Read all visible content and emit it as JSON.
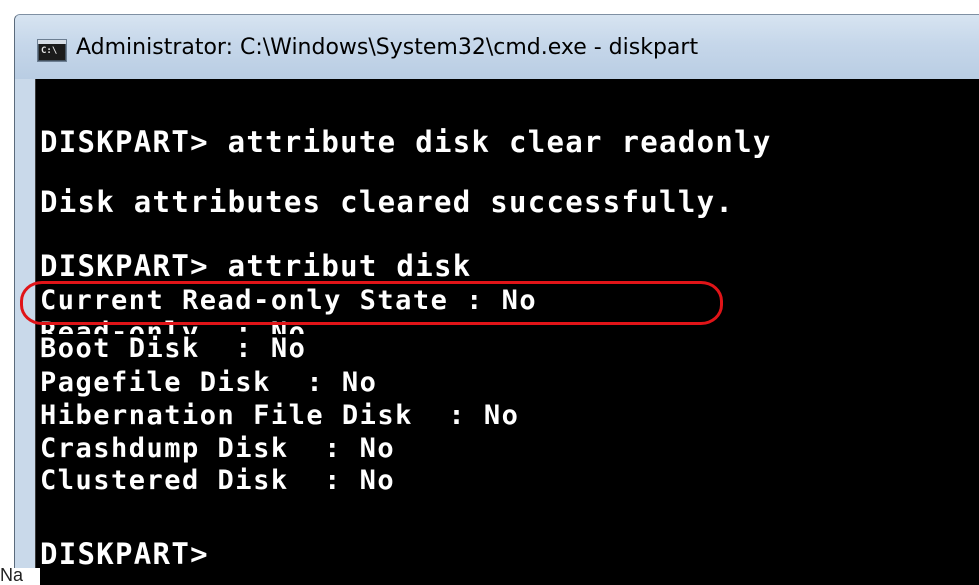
{
  "window": {
    "title": "Administrator: C:\\Windows\\System32\\cmd.exe - diskpart",
    "icon": "console-icon",
    "icon_glyph": "C:\\"
  },
  "console": {
    "lines": [
      "DISKPART> attribute disk clear readonly",
      "Disk attributes cleared successfully.",
      "DISKPART> attribut disk",
      "Current Read-only State : No",
      "Read-only  : No",
      "Boot Disk  : No",
      "Pagefile Disk  : No",
      "Hibernation File Disk  : No",
      "Crashdump Disk  : No",
      "Clustered Disk  : No",
      "DISKPART> "
    ],
    "highlighted_line": "Current Read-only State : No",
    "highlight_color": "#e01418"
  },
  "caption": "Na"
}
